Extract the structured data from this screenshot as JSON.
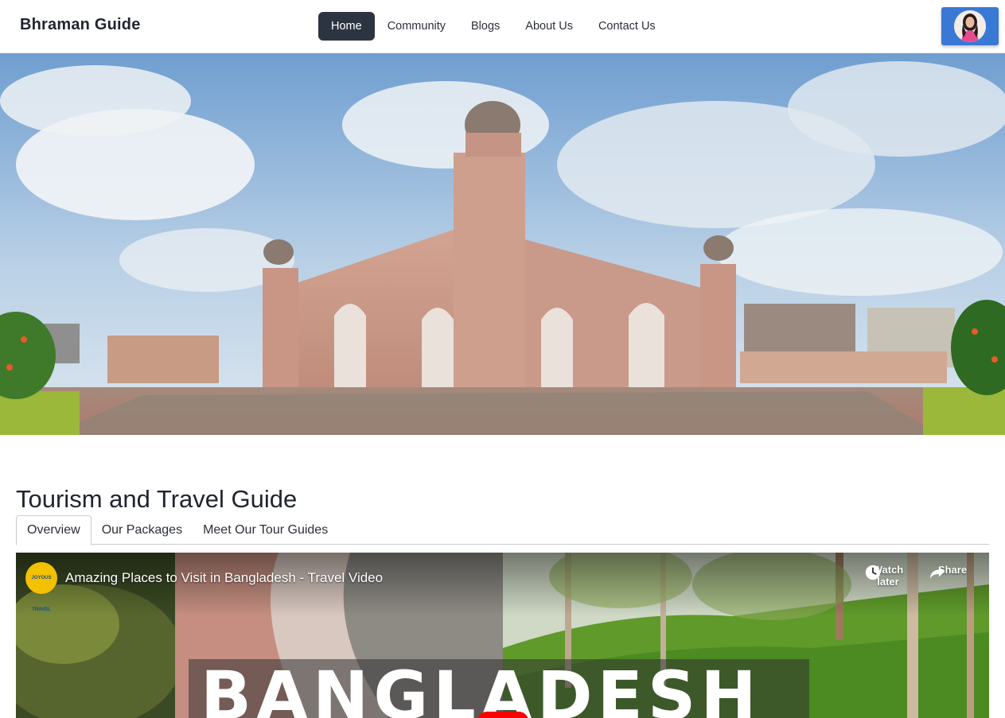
{
  "navbar": {
    "brand": "Bhraman Guide",
    "links": [
      {
        "label": "Home",
        "active": true
      },
      {
        "label": "Community",
        "active": false
      },
      {
        "label": "Blogs",
        "active": false
      },
      {
        "label": "About Us",
        "active": false
      },
      {
        "label": "Contact Us",
        "active": false
      }
    ],
    "profile_button_color": "#3a78d6"
  },
  "hero": {
    "image_subject": "lalbagh-fort-mausoleum-photo"
  },
  "section": {
    "title": "Tourism and Travel Guide",
    "tabs": [
      {
        "label": "Overview",
        "active": true
      },
      {
        "label": "Our Packages",
        "active": false
      },
      {
        "label": "Meet Our Tour Guides",
        "active": false
      }
    ]
  },
  "video": {
    "title": "Amazing Places to Visit in Bangladesh - Travel Video",
    "channel_logo_text": "JOYOUS TRAVEL",
    "watch_later_label": "Watch later",
    "share_label": "Share",
    "banner_text": "BANGLADESH"
  },
  "colors": {
    "nav_active_bg": "#2d3441",
    "youtube_red": "#ff0000"
  }
}
